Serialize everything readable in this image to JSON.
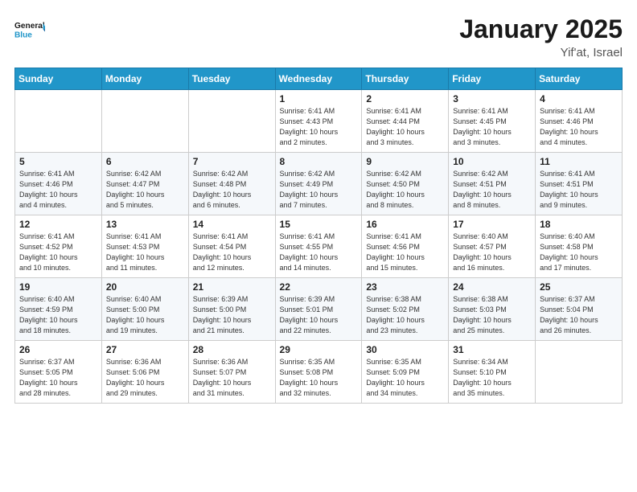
{
  "header": {
    "logo_text_general": "General",
    "logo_text_blue": "Blue",
    "main_title": "January 2025",
    "subtitle": "Yif'at, Israel"
  },
  "days_of_week": [
    "Sunday",
    "Monday",
    "Tuesday",
    "Wednesday",
    "Thursday",
    "Friday",
    "Saturday"
  ],
  "weeks": [
    [
      {
        "day": "",
        "info": ""
      },
      {
        "day": "",
        "info": ""
      },
      {
        "day": "",
        "info": ""
      },
      {
        "day": "1",
        "info": "Sunrise: 6:41 AM\nSunset: 4:43 PM\nDaylight: 10 hours\nand 2 minutes."
      },
      {
        "day": "2",
        "info": "Sunrise: 6:41 AM\nSunset: 4:44 PM\nDaylight: 10 hours\nand 3 minutes."
      },
      {
        "day": "3",
        "info": "Sunrise: 6:41 AM\nSunset: 4:45 PM\nDaylight: 10 hours\nand 3 minutes."
      },
      {
        "day": "4",
        "info": "Sunrise: 6:41 AM\nSunset: 4:46 PM\nDaylight: 10 hours\nand 4 minutes."
      }
    ],
    [
      {
        "day": "5",
        "info": "Sunrise: 6:41 AM\nSunset: 4:46 PM\nDaylight: 10 hours\nand 4 minutes."
      },
      {
        "day": "6",
        "info": "Sunrise: 6:42 AM\nSunset: 4:47 PM\nDaylight: 10 hours\nand 5 minutes."
      },
      {
        "day": "7",
        "info": "Sunrise: 6:42 AM\nSunset: 4:48 PM\nDaylight: 10 hours\nand 6 minutes."
      },
      {
        "day": "8",
        "info": "Sunrise: 6:42 AM\nSunset: 4:49 PM\nDaylight: 10 hours\nand 7 minutes."
      },
      {
        "day": "9",
        "info": "Sunrise: 6:42 AM\nSunset: 4:50 PM\nDaylight: 10 hours\nand 8 minutes."
      },
      {
        "day": "10",
        "info": "Sunrise: 6:42 AM\nSunset: 4:51 PM\nDaylight: 10 hours\nand 8 minutes."
      },
      {
        "day": "11",
        "info": "Sunrise: 6:41 AM\nSunset: 4:51 PM\nDaylight: 10 hours\nand 9 minutes."
      }
    ],
    [
      {
        "day": "12",
        "info": "Sunrise: 6:41 AM\nSunset: 4:52 PM\nDaylight: 10 hours\nand 10 minutes."
      },
      {
        "day": "13",
        "info": "Sunrise: 6:41 AM\nSunset: 4:53 PM\nDaylight: 10 hours\nand 11 minutes."
      },
      {
        "day": "14",
        "info": "Sunrise: 6:41 AM\nSunset: 4:54 PM\nDaylight: 10 hours\nand 12 minutes."
      },
      {
        "day": "15",
        "info": "Sunrise: 6:41 AM\nSunset: 4:55 PM\nDaylight: 10 hours\nand 14 minutes."
      },
      {
        "day": "16",
        "info": "Sunrise: 6:41 AM\nSunset: 4:56 PM\nDaylight: 10 hours\nand 15 minutes."
      },
      {
        "day": "17",
        "info": "Sunrise: 6:40 AM\nSunset: 4:57 PM\nDaylight: 10 hours\nand 16 minutes."
      },
      {
        "day": "18",
        "info": "Sunrise: 6:40 AM\nSunset: 4:58 PM\nDaylight: 10 hours\nand 17 minutes."
      }
    ],
    [
      {
        "day": "19",
        "info": "Sunrise: 6:40 AM\nSunset: 4:59 PM\nDaylight: 10 hours\nand 18 minutes."
      },
      {
        "day": "20",
        "info": "Sunrise: 6:40 AM\nSunset: 5:00 PM\nDaylight: 10 hours\nand 19 minutes."
      },
      {
        "day": "21",
        "info": "Sunrise: 6:39 AM\nSunset: 5:00 PM\nDaylight: 10 hours\nand 21 minutes."
      },
      {
        "day": "22",
        "info": "Sunrise: 6:39 AM\nSunset: 5:01 PM\nDaylight: 10 hours\nand 22 minutes."
      },
      {
        "day": "23",
        "info": "Sunrise: 6:38 AM\nSunset: 5:02 PM\nDaylight: 10 hours\nand 23 minutes."
      },
      {
        "day": "24",
        "info": "Sunrise: 6:38 AM\nSunset: 5:03 PM\nDaylight: 10 hours\nand 25 minutes."
      },
      {
        "day": "25",
        "info": "Sunrise: 6:37 AM\nSunset: 5:04 PM\nDaylight: 10 hours\nand 26 minutes."
      }
    ],
    [
      {
        "day": "26",
        "info": "Sunrise: 6:37 AM\nSunset: 5:05 PM\nDaylight: 10 hours\nand 28 minutes."
      },
      {
        "day": "27",
        "info": "Sunrise: 6:36 AM\nSunset: 5:06 PM\nDaylight: 10 hours\nand 29 minutes."
      },
      {
        "day": "28",
        "info": "Sunrise: 6:36 AM\nSunset: 5:07 PM\nDaylight: 10 hours\nand 31 minutes."
      },
      {
        "day": "29",
        "info": "Sunrise: 6:35 AM\nSunset: 5:08 PM\nDaylight: 10 hours\nand 32 minutes."
      },
      {
        "day": "30",
        "info": "Sunrise: 6:35 AM\nSunset: 5:09 PM\nDaylight: 10 hours\nand 34 minutes."
      },
      {
        "day": "31",
        "info": "Sunrise: 6:34 AM\nSunset: 5:10 PM\nDaylight: 10 hours\nand 35 minutes."
      },
      {
        "day": "",
        "info": ""
      }
    ]
  ]
}
